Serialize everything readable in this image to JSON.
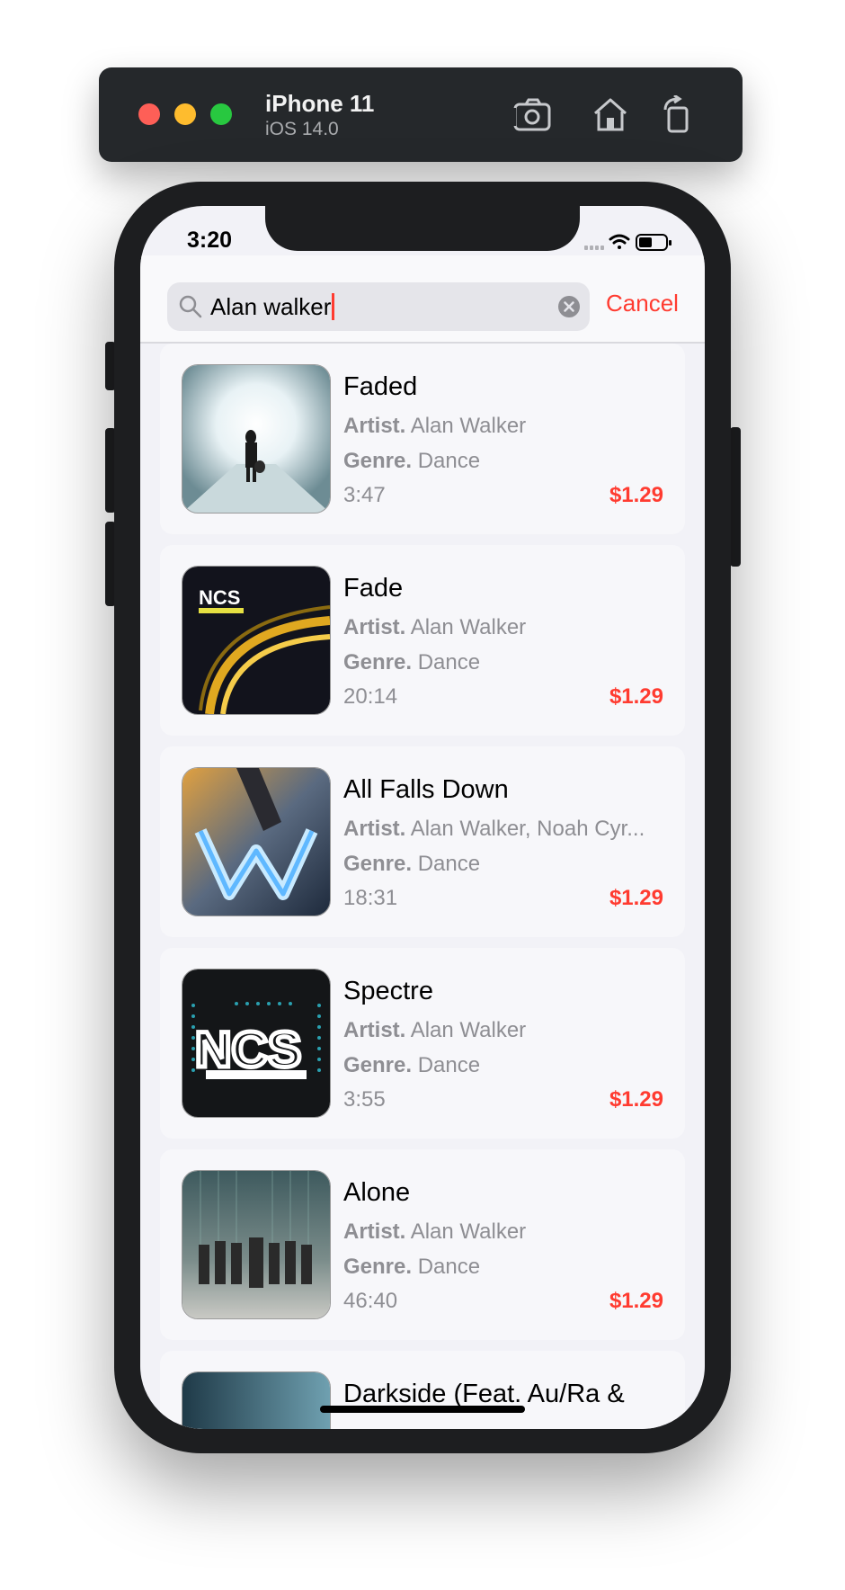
{
  "simulator": {
    "device_name": "iPhone 11",
    "os_version": "iOS 14.0",
    "icons": [
      "screenshot-icon",
      "home-icon",
      "rotate-icon"
    ]
  },
  "status_bar": {
    "time": "3:20"
  },
  "search": {
    "query": "Alan walker",
    "cancel_label": "Cancel"
  },
  "labels": {
    "artist": "Artist.",
    "genre": "Genre."
  },
  "results": [
    {
      "title": "Faded",
      "artist": "Alan Walker",
      "genre": "Dance",
      "duration": "3:47",
      "price": "$1.29"
    },
    {
      "title": "Fade",
      "artist": "Alan Walker",
      "genre": "Dance",
      "duration": "20:14",
      "price": "$1.29"
    },
    {
      "title": "All Falls Down",
      "artist": "Alan Walker, Noah Cyr...",
      "genre": "Dance",
      "duration": "18:31",
      "price": "$1.29"
    },
    {
      "title": "Spectre",
      "artist": "Alan Walker",
      "genre": "Dance",
      "duration": "3:55",
      "price": "$1.29"
    },
    {
      "title": "Alone",
      "artist": "Alan Walker",
      "genre": "Dance",
      "duration": "46:40",
      "price": "$1.29"
    },
    {
      "title": "Darkside (Feat. Au/Ra &",
      "artist": "",
      "genre": "",
      "duration": "",
      "price": ""
    }
  ],
  "colors": {
    "accent": "#ff3b30",
    "secondary_text": "#8e8e93",
    "card": "#f7f7fa"
  }
}
